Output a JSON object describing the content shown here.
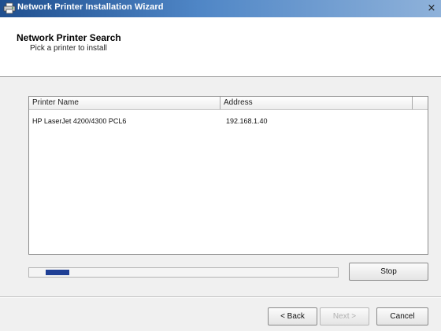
{
  "window": {
    "title": "Network Printer Installation Wizard",
    "close_glyph": "×",
    "icon": "printer-icon"
  },
  "header": {
    "title": "Network Printer Search",
    "subtitle": "Pick a printer to install"
  },
  "printer_list": {
    "columns": [
      "Printer Name",
      "Address"
    ],
    "rows": [
      {
        "name": "HP LaserJet 4200/4300 PCL6",
        "address": "192.168.1.40"
      }
    ]
  },
  "search_progress": {
    "state": "searching",
    "fill_fraction": 0.09
  },
  "buttons": {
    "stop": "Stop",
    "back": "< Back",
    "next": "Next >",
    "cancel": "Cancel"
  }
}
